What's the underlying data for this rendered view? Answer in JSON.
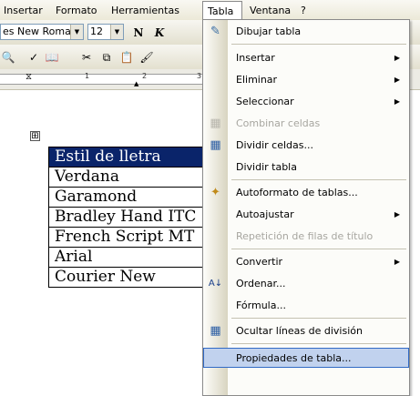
{
  "menubar": {
    "items": [
      {
        "label": "Insertar"
      },
      {
        "label": "Formato"
      },
      {
        "label": "Herramientas"
      },
      {
        "label": "Tabla"
      },
      {
        "label": "Ventana"
      },
      {
        "label": "?"
      }
    ]
  },
  "toolbar": {
    "font_value": "es New Roman",
    "size_value": "12",
    "bold_label": "N",
    "italic_label": "K"
  },
  "ruler": {
    "ticks": [
      "1",
      "2",
      "3"
    ]
  },
  "document": {
    "move_handle": "⊞",
    "rows": [
      "Estil de lletra",
      "Verdana",
      "Garamond",
      "Bradley Hand ITC",
      "French Script MT",
      "Arial",
      "Courier New"
    ]
  },
  "menu": {
    "items": [
      {
        "label": "Dibujar tabla"
      },
      {
        "label": "Insertar"
      },
      {
        "label": "Eliminar"
      },
      {
        "label": "Seleccionar"
      },
      {
        "label": "Combinar celdas"
      },
      {
        "label": "Dividir celdas..."
      },
      {
        "label": "Dividir tabla"
      },
      {
        "label": "Autoformato de tablas..."
      },
      {
        "label": "Autoajustar"
      },
      {
        "label": "Repetición de filas de título"
      },
      {
        "label": "Convertir"
      },
      {
        "label": "Ordenar..."
      },
      {
        "label": "Fórmula..."
      },
      {
        "label": "Ocultar líneas de división"
      },
      {
        "label": "Propiedades de tabla..."
      }
    ]
  },
  "colors": {
    "selection_bg": "#0a246a",
    "menu_highlight_bg": "#c1d2ee",
    "menu_highlight_border": "#316ac5"
  },
  "icons": [
    "draw-table-icon",
    "merge-cells-icon",
    "split-cells-icon",
    "autoformat-icon",
    "sort-icon",
    "hide-gridlines-icon"
  ]
}
